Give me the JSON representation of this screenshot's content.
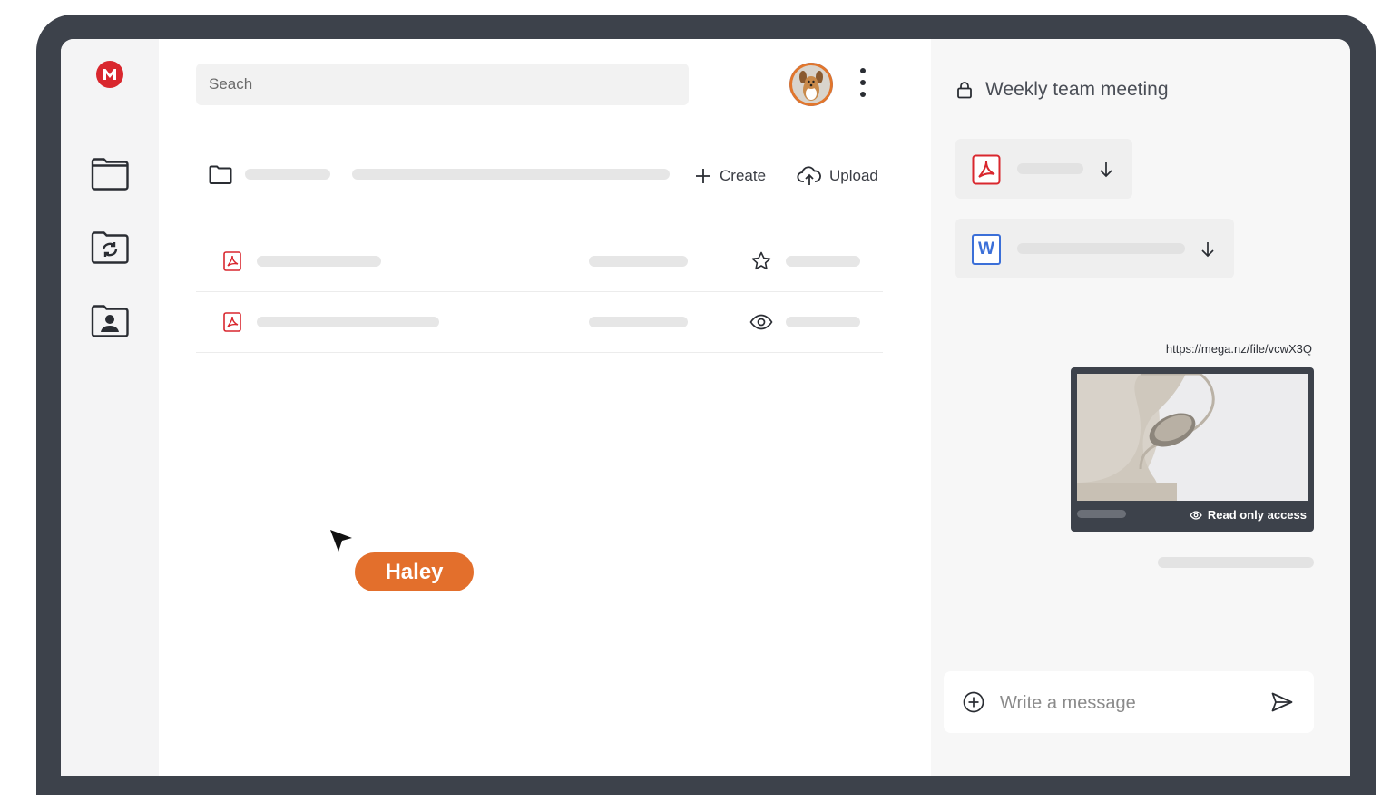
{
  "search": {
    "placeholder": "Seach"
  },
  "toolbar": {
    "create_label": "Create",
    "upload_label": "Upload"
  },
  "chat": {
    "title": "Weekly team meeting",
    "files": [
      {
        "icon": "pdf-icon"
      },
      {
        "icon": "word-icon",
        "letter": "W"
      }
    ],
    "link": "https://mega.nz/file/vcwX3Q",
    "preview": {
      "access_label": "Read only access"
    },
    "compose": {
      "placeholder": "Write a message"
    }
  },
  "collaborator": {
    "name": "Haley",
    "color": "#e36f2c"
  },
  "colors": {
    "brand": "#d9272e",
    "frame": "#3d424b",
    "word": "#3b6fd8"
  },
  "icons": [
    "mega-logo-icon",
    "folder-icon",
    "sync-folder-icon",
    "shared-folder-icon",
    "star-icon",
    "eye-icon",
    "lock-icon",
    "download-icon",
    "send-icon",
    "add-icon",
    "upload-cloud-icon",
    "more-vertical-icon"
  ]
}
